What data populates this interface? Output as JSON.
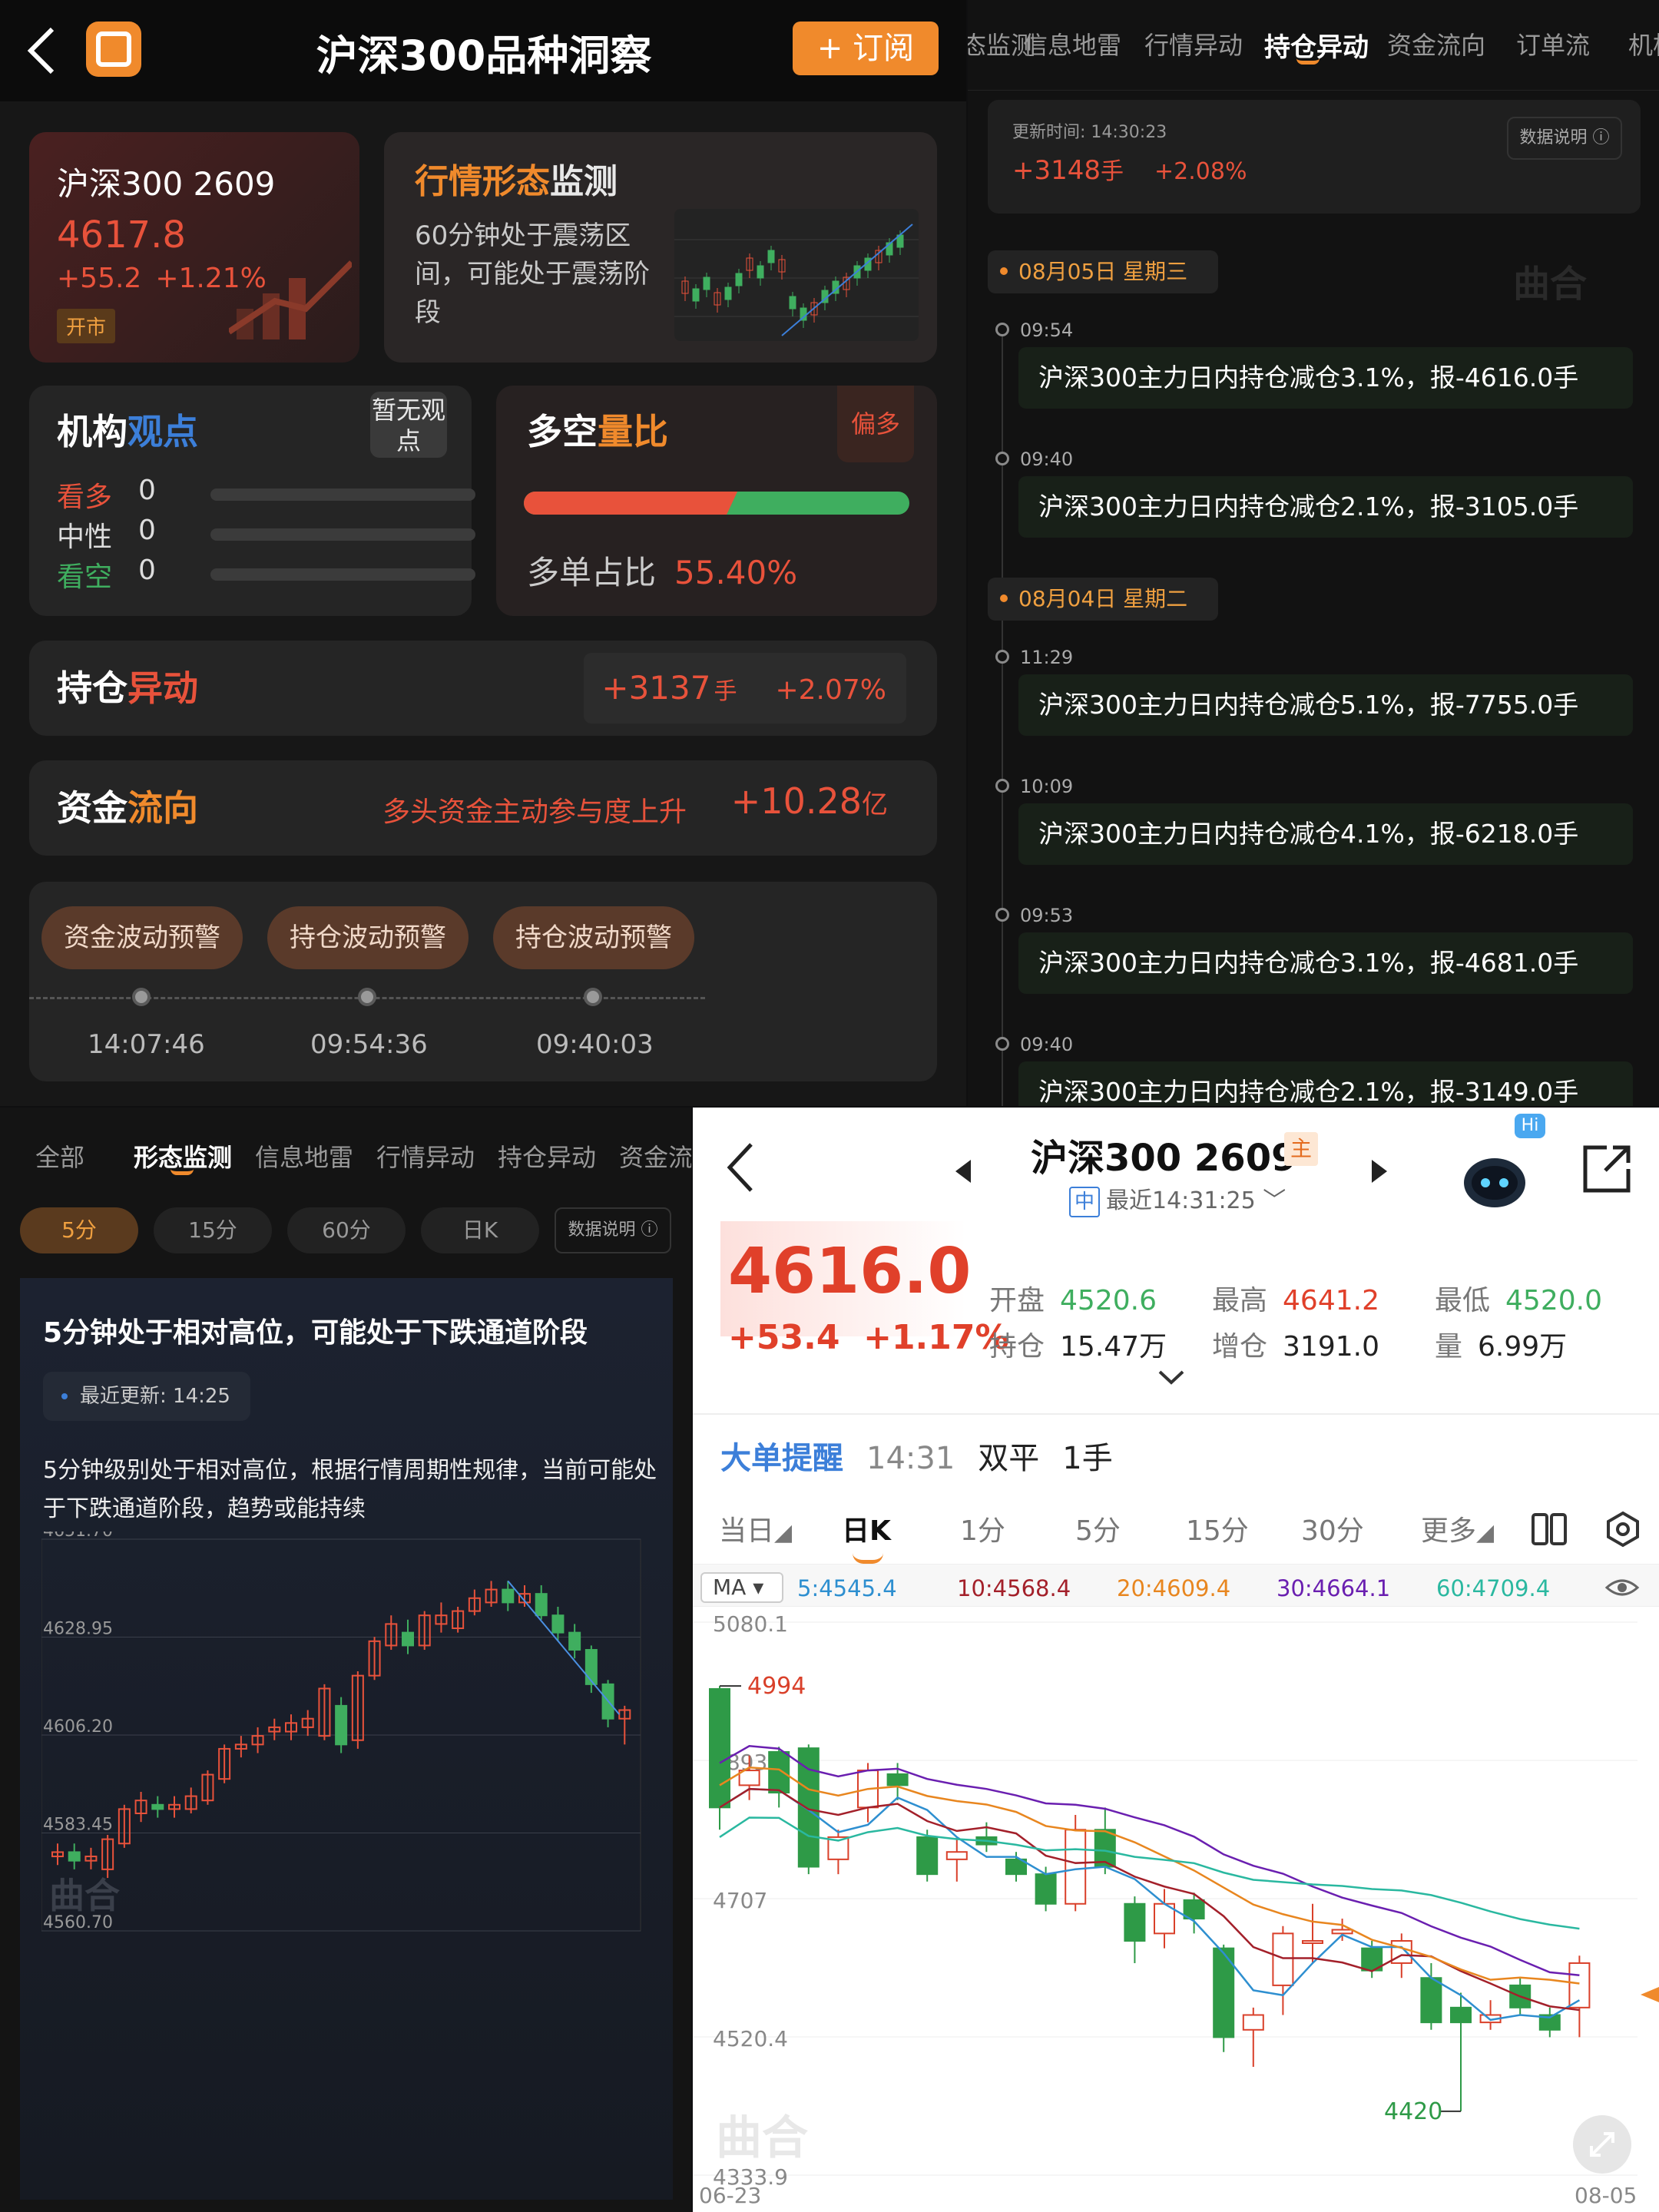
{
  "top_left": {
    "title": "沪深300品种洞察",
    "subscribe": "+ 订阅",
    "quote": {
      "name": "沪深300 2609",
      "price": "4617.8",
      "change": "+55.2",
      "pct": "+1.21%",
      "status": "开市"
    },
    "pattern": {
      "title_a": "行情形态",
      "title_b": "监测",
      "text": "60分钟处于震荡区间，可能处于震荡阶段"
    },
    "institution": {
      "title_a": "机构",
      "title_b": "观点",
      "tag": "暂无观点",
      "rows": [
        {
          "label": "看多",
          "value": "0"
        },
        {
          "label": "中性",
          "value": "0"
        },
        {
          "label": "看空",
          "value": "0"
        }
      ]
    },
    "ratio": {
      "title_a": "多空",
      "title_b": "量比",
      "tag": "偏多",
      "label": "多单占比",
      "value": "55.40%",
      "long_fraction": 0.554
    },
    "position": {
      "title_a": "持仓",
      "title_b": "异动",
      "value": "+3137",
      "unit": "手",
      "pct": "+2.07%"
    },
    "fund": {
      "title_a": "资金",
      "title_b": "流向",
      "text": "多头资金主动参与度上升",
      "value": "+10.28",
      "unit": "亿"
    },
    "alerts": [
      {
        "label": "资金波动预警",
        "time": "14:07:46"
      },
      {
        "label": "持仓波动预警",
        "time": "09:54:36"
      },
      {
        "label": "持仓波动预警",
        "time": "09:40:03"
      }
    ]
  },
  "top_right": {
    "tabs": [
      "态监测",
      "信息地雷",
      "行情异动",
      "持仓异动",
      "资金流向",
      "订单流",
      "机构"
    ],
    "active_tab": "持仓异动",
    "update_time": "更新时间: 14:30:23",
    "value": "+3148",
    "unit": "手",
    "pct": "+2.08%",
    "info": "数据说明",
    "watermark": "曲合",
    "days": [
      {
        "date": "08月05日 星期三",
        "events": [
          {
            "time": "09:54",
            "text": "沪深300主力日内持仓减仓3.1%，报-4616.0手"
          },
          {
            "time": "09:40",
            "text": "沪深300主力日内持仓减仓2.1%，报-3105.0手"
          }
        ]
      },
      {
        "date": "08月04日 星期二",
        "events": [
          {
            "time": "11:29",
            "text": "沪深300主力日内持仓减仓5.1%，报-7755.0手"
          },
          {
            "time": "10:09",
            "text": "沪深300主力日内持仓减仓4.1%，报-6218.0手"
          },
          {
            "time": "09:53",
            "text": "沪深300主力日内持仓减仓3.1%，报-4681.0手"
          },
          {
            "time": "09:40",
            "text": "沪深300主力日内持仓减仓2.1%，报-3149.0手"
          }
        ]
      }
    ]
  },
  "bottom_left": {
    "tabs": [
      "全部",
      "形态监测",
      "信息地雷",
      "行情异动",
      "持仓异动",
      "资金流"
    ],
    "active_tab": "形态监测",
    "periods": [
      "5分",
      "15分",
      "60分",
      "日K"
    ],
    "active_period": "5分",
    "info": "数据说明",
    "headline": "5分钟处于相对高位，可能处于下跌通道阶段",
    "last_update": "最近更新: 14:25",
    "description": "5分钟级别处于相对高位，根据行情周期性规律，当前可能处于下跌通道阶段，趋势或能持续",
    "watermark": "曲合",
    "chart_data": {
      "type": "candlestick",
      "y_ticks": [
        "4651.70",
        "4628.95",
        "4606.20",
        "4583.45",
        "4560.70"
      ],
      "ylim": [
        4560.7,
        4651.7
      ],
      "candles": [
        [
          4578,
          4579,
          4576,
          4581
        ],
        [
          4579,
          4577,
          4575,
          4581
        ],
        [
          4577,
          4578,
          4575,
          4580
        ],
        [
          4575,
          4582,
          4573,
          4583
        ],
        [
          4581,
          4589,
          4580,
          4590
        ],
        [
          4588,
          4591,
          4586,
          4593
        ],
        [
          4590,
          4589,
          4587,
          4592
        ],
        [
          4589,
          4590,
          4587,
          4592
        ],
        [
          4589,
          4592,
          4588,
          4594
        ],
        [
          4591,
          4597,
          4590,
          4598
        ],
        [
          4596,
          4603,
          4595,
          4604
        ],
        [
          4603,
          4604,
          4601,
          4606
        ],
        [
          4604,
          4606,
          4602,
          4608
        ],
        [
          4607,
          4608,
          4605,
          4610
        ],
        [
          4607,
          4609,
          4605,
          4611
        ],
        [
          4608,
          4610,
          4606,
          4612
        ],
        [
          4606,
          4617,
          4605,
          4618
        ],
        [
          4613,
          4604,
          4602,
          4615
        ],
        [
          4605,
          4620,
          4603,
          4621
        ],
        [
          4620,
          4628,
          4619,
          4629
        ],
        [
          4627,
          4632,
          4626,
          4634
        ],
        [
          4630,
          4627,
          4625,
          4633
        ],
        [
          4627,
          4634,
          4626,
          4635
        ],
        [
          4632,
          4634,
          4630,
          4637
        ],
        [
          4631,
          4635,
          4630,
          4636
        ],
        [
          4635,
          4638,
          4634,
          4640
        ],
        [
          4637,
          4640,
          4636,
          4642
        ],
        [
          4640,
          4637,
          4635,
          4642
        ],
        [
          4637,
          4639,
          4636,
          4641
        ],
        [
          4639,
          4634,
          4633,
          4641
        ],
        [
          4634,
          4630,
          4628,
          4636
        ],
        [
          4630,
          4626,
          4624,
          4632
        ],
        [
          4626,
          4618,
          4616,
          4627
        ],
        [
          4618,
          4610,
          4608,
          4619
        ],
        [
          4610,
          4612,
          4604,
          4613
        ]
      ]
    }
  },
  "bottom_right": {
    "title": "沪深300 2609",
    "main_tag": "主",
    "exchange_tag": "中",
    "latest": "最近14:31:25",
    "hi_badge": "Hi",
    "price": "4616.0",
    "change": "+53.4",
    "pct": "+1.17%",
    "stats": [
      {
        "label": "开盘",
        "value": "4520.6",
        "color": "#3fae5f"
      },
      {
        "label": "最高",
        "value": "4641.2",
        "color": "#e0402a"
      },
      {
        "label": "最低",
        "value": "4520.0",
        "color": "#3fae5f"
      },
      {
        "label": "持仓",
        "value": "15.47万",
        "color": "#222"
      },
      {
        "label": "增仓",
        "value": "3191.0",
        "color": "#222"
      },
      {
        "label": "量",
        "value": "6.99万",
        "color": "#222"
      }
    ],
    "big_order": {
      "label": "大单提醒",
      "time": "14:31",
      "type": "双平",
      "qty": "1手"
    },
    "periods": [
      "当日",
      "日K",
      "1分",
      "5分",
      "15分",
      "30分",
      "更多"
    ],
    "active_period": "日K",
    "ma_button": "MA",
    "ma": [
      {
        "label": "5:4545.4",
        "color": "#2e8fd0"
      },
      {
        "label": "10:4568.4",
        "color": "#a3202a"
      },
      {
        "label": "20:4609.4",
        "color": "#e8861f"
      },
      {
        "label": "30:4664.1",
        "color": "#6a1fb0"
      },
      {
        "label": "60:4709.4",
        "color": "#2ab8a0"
      }
    ],
    "watermark": "曲合",
    "chart_data": {
      "type": "candlestick",
      "y_ticks": [
        "5080.1",
        "4893.6",
        "4707",
        "4520.4",
        "4333.9"
      ],
      "ylim": [
        4333.9,
        5080.1
      ],
      "x_start": "06-23",
      "x_end": "08-05",
      "high_label": "4994",
      "low_label": "4420",
      "candles": [
        [
          4990,
          4830,
          4800,
          4994
        ],
        [
          4860,
          4880,
          4840,
          4900
        ],
        [
          4905,
          4850,
          4830,
          4912
        ],
        [
          4910,
          4750,
          4740,
          4915
        ],
        [
          4760,
          4790,
          4740,
          4800
        ],
        [
          4830,
          4880,
          4810,
          4890
        ],
        [
          4875,
          4860,
          4840,
          4890
        ],
        [
          4790,
          4740,
          4730,
          4800
        ],
        [
          4760,
          4770,
          4730,
          4790
        ],
        [
          4790,
          4780,
          4770,
          4810
        ],
        [
          4760,
          4740,
          4730,
          4770
        ],
        [
          4740,
          4700,
          4690,
          4750
        ],
        [
          4700,
          4800,
          4690,
          4820
        ],
        [
          4800,
          4750,
          4740,
          4830
        ],
        [
          4700,
          4650,
          4620,
          4710
        ],
        [
          4660,
          4700,
          4640,
          4720
        ],
        [
          4705,
          4680,
          4660,
          4715
        ],
        [
          4640,
          4520,
          4500,
          4645
        ],
        [
          4530,
          4550,
          4480,
          4560
        ],
        [
          4590,
          4660,
          4550,
          4670
        ],
        [
          4650,
          4650,
          4620,
          4700
        ],
        [
          4660,
          4665,
          4650,
          4680
        ],
        [
          4640,
          4610,
          4600,
          4650
        ],
        [
          4620,
          4650,
          4600,
          4660
        ],
        [
          4600,
          4540,
          4530,
          4620
        ],
        [
          4560,
          4540,
          4420,
          4580
        ],
        [
          4540,
          4550,
          4530,
          4570
        ],
        [
          4590,
          4560,
          4550,
          4600
        ],
        [
          4550,
          4530,
          4520,
          4560
        ],
        [
          4560,
          4620,
          4520,
          4630
        ]
      ]
    }
  }
}
